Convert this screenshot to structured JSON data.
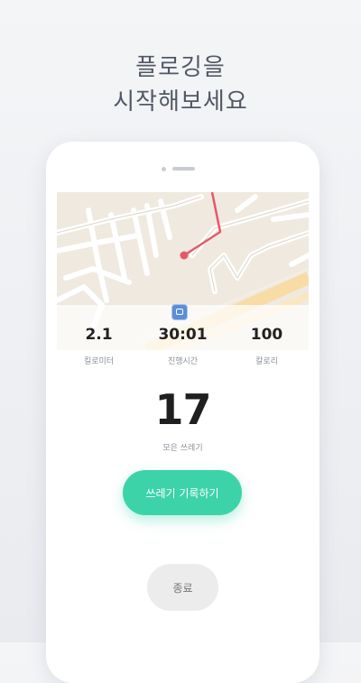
{
  "headline": {
    "line1": "플로깅을",
    "line2": "시작해보세요"
  },
  "stats": [
    {
      "value": "2.1",
      "label": "킬로미터"
    },
    {
      "value": "30:01",
      "label": "진행시간"
    },
    {
      "value": "100",
      "label": "칼로리"
    }
  ],
  "trash": {
    "count": "17",
    "label": "모은 쓰레기"
  },
  "buttons": {
    "record": "쓰레기 기록하기",
    "end": "종료"
  },
  "colors": {
    "accent": "#3dd3a8",
    "route": "#e5586a",
    "headline": "#525866"
  },
  "icons": {
    "map_marker": "bus-stop-icon",
    "location": "current-location-dot"
  }
}
